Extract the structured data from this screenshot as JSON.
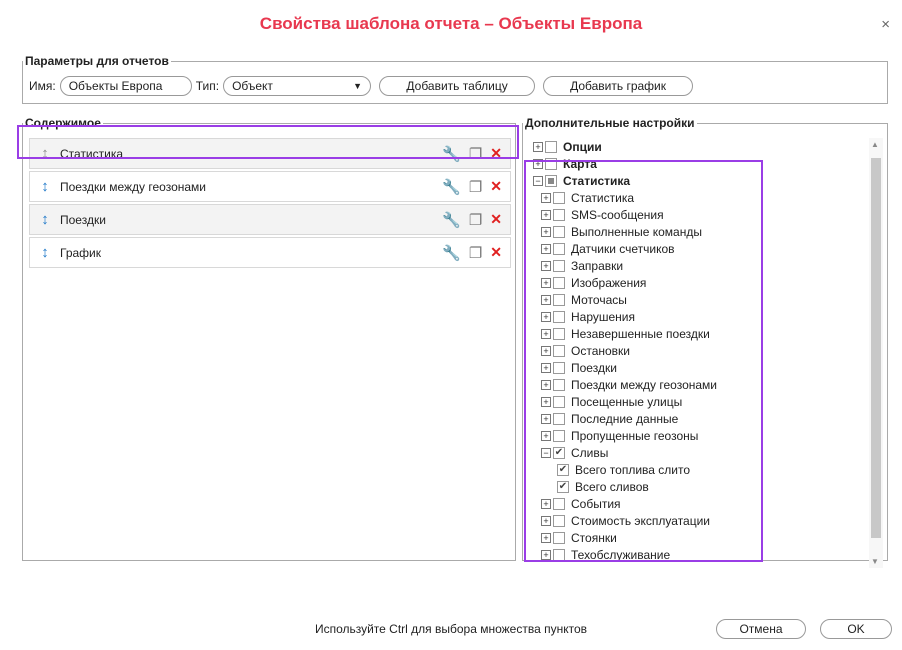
{
  "dialog": {
    "title": "Свойства шаблона отчета – Объекты Европа",
    "close_glyph": "×",
    "title_color": "#e8384f"
  },
  "params": {
    "legend": "Параметры для отчетов",
    "name_label": "Имя:",
    "name_value": "Объекты Европа",
    "type_label": "Тип:",
    "type_value": "Объект",
    "add_table": "Добавить таблицу",
    "add_graph": "Добавить график"
  },
  "content": {
    "legend": "Содержимое",
    "rows": [
      {
        "label": "Статистика",
        "handle_icon": "move-icon",
        "handle_color": "grey"
      },
      {
        "label": "Поездки между геозонами",
        "handle_icon": "move-icon",
        "handle_color": "blue"
      },
      {
        "label": "Поездки",
        "handle_icon": "move-icon",
        "handle_color": "blue"
      },
      {
        "label": "График",
        "handle_icon": "move-icon",
        "handle_color": "blue"
      }
    ],
    "row_icons": [
      "wrench-icon",
      "copy-icon",
      "delete-icon"
    ]
  },
  "extra": {
    "legend": "Дополнительные настройки",
    "tree": [
      {
        "label": "Опции",
        "level": 1,
        "expander": "+",
        "check": "none",
        "bold": true
      },
      {
        "label": "Карта",
        "level": 1,
        "expander": "+",
        "check": "none",
        "bold": true
      },
      {
        "label": "Статистика",
        "level": 1,
        "expander": "−",
        "check": "partial",
        "bold": true
      },
      {
        "label": "Статистика",
        "level": 2,
        "expander": "+",
        "check": "none"
      },
      {
        "label": "SMS-сообщения",
        "level": 2,
        "expander": "+",
        "check": "none"
      },
      {
        "label": "Выполненные команды",
        "level": 2,
        "expander": "+",
        "check": "none"
      },
      {
        "label": "Датчики счетчиков",
        "level": 2,
        "expander": "+",
        "check": "none"
      },
      {
        "label": "Заправки",
        "level": 2,
        "expander": "+",
        "check": "none"
      },
      {
        "label": "Изображения",
        "level": 2,
        "expander": "+",
        "check": "none"
      },
      {
        "label": "Моточасы",
        "level": 2,
        "expander": "+",
        "check": "none"
      },
      {
        "label": "Нарушения",
        "level": 2,
        "expander": "+",
        "check": "none"
      },
      {
        "label": "Незавершенные поездки",
        "level": 2,
        "expander": "+",
        "check": "none"
      },
      {
        "label": "Остановки",
        "level": 2,
        "expander": "+",
        "check": "none"
      },
      {
        "label": "Поездки",
        "level": 2,
        "expander": "+",
        "check": "none"
      },
      {
        "label": "Поездки между геозонами",
        "level": 2,
        "expander": "+",
        "check": "none"
      },
      {
        "label": "Посещенные улицы",
        "level": 2,
        "expander": "+",
        "check": "none"
      },
      {
        "label": "Последние данные",
        "level": 2,
        "expander": "+",
        "check": "none"
      },
      {
        "label": "Пропущенные геозоны",
        "level": 2,
        "expander": "+",
        "check": "none"
      },
      {
        "label": "Сливы",
        "level": 2,
        "expander": "−",
        "check": "checked"
      },
      {
        "label": "Всего топлива слито",
        "level": 3,
        "expander": "",
        "check": "checked"
      },
      {
        "label": "Всего сливов",
        "level": 3,
        "expander": "",
        "check": "checked"
      },
      {
        "label": "События",
        "level": 2,
        "expander": "+",
        "check": "none"
      },
      {
        "label": "Стоимость эксплуатации",
        "level": 2,
        "expander": "+",
        "check": "none"
      },
      {
        "label": "Стоянки",
        "level": 2,
        "expander": "+",
        "check": "none"
      },
      {
        "label": "Техобслуживание",
        "level": 2,
        "expander": "+",
        "check": "none"
      }
    ]
  },
  "footer": {
    "hint": "Используйте Ctrl для выбора множества пунктов",
    "cancel": "Отмена",
    "ok": "OK"
  },
  "colors": {
    "highlight": "#9a3de6",
    "delete": "#e02020",
    "handle_blue": "#1f78c8"
  }
}
